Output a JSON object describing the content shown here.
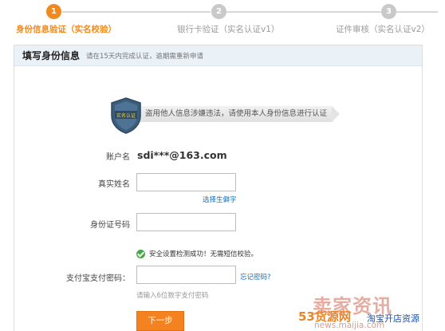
{
  "stepper": {
    "steps": [
      {
        "number": "1",
        "label": "身份信息验证（实名校验）",
        "state": "active"
      },
      {
        "number": "2",
        "label": "银行卡验证（实名认证v1）",
        "state": "inactive"
      },
      {
        "number": "3",
        "label": "证件审核（实名认证v2）",
        "state": "inactive"
      }
    ]
  },
  "panel": {
    "title": "填写身份信息",
    "subtitle": "请在15天内完成认证，逾期需重新申请"
  },
  "banner": {
    "shield_text": "实名认证",
    "message": "盗用他人信息涉嫌违法，请使用本人身份信息进行认证"
  },
  "form": {
    "account_label": "账户名",
    "account_value": "sdi***@163.com",
    "real_name_label": "真实姓名",
    "real_name_value": "",
    "rare_char_link": "选择生僻字",
    "id_number_label": "身份证号码",
    "id_number_value": "",
    "security_check_text": "安全设置检测成功！无需短信校验。",
    "pay_password_label": "支付宝支付密码：",
    "pay_password_value": "",
    "forgot_password_link": "忘记密码?",
    "pay_password_hint": "请输入6位数字支付密码",
    "next_button": "下一步"
  },
  "watermark": {
    "main": "卖家资讯",
    "number": "53货源网",
    "sub": "淘宝开店资源",
    "url": "news.maijia.com"
  },
  "colors": {
    "accent": "#f08a1e",
    "button": "#f58220",
    "link": "#1a6fb3",
    "success": "#3fae3f",
    "header_bg": "#eaf1f7"
  }
}
